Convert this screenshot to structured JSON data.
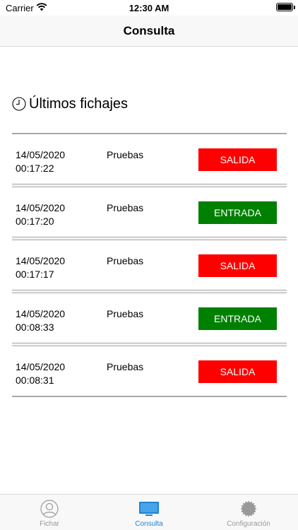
{
  "status_bar": {
    "carrier": "Carrier",
    "time": "12:30 AM"
  },
  "nav": {
    "title": "Consulta"
  },
  "section": {
    "title": "Últimos fichajes"
  },
  "records": [
    {
      "date": "14/05/2020",
      "time": "00:17:22",
      "name": "Pruebas",
      "type": "SALIDA"
    },
    {
      "date": "14/05/2020",
      "time": "00:17:20",
      "name": "Pruebas",
      "type": "ENTRADA"
    },
    {
      "date": "14/05/2020",
      "time": "00:17:17",
      "name": "Pruebas",
      "type": "SALIDA"
    },
    {
      "date": "14/05/2020",
      "time": "00:08:33",
      "name": "Pruebas",
      "type": "ENTRADA"
    },
    {
      "date": "14/05/2020",
      "time": "00:08:31",
      "name": "Pruebas",
      "type": "SALIDA"
    }
  ],
  "colors": {
    "salida": "#ff0000",
    "entrada": "#008000",
    "active_tab": "#1a84d6",
    "inactive_tab": "#999999"
  },
  "tabs": [
    {
      "label": "Fichar",
      "icon": "user-icon",
      "active": false
    },
    {
      "label": "Consulta",
      "icon": "monitor-icon",
      "active": true
    },
    {
      "label": "Configuración",
      "icon": "gear-icon",
      "active": false
    }
  ]
}
